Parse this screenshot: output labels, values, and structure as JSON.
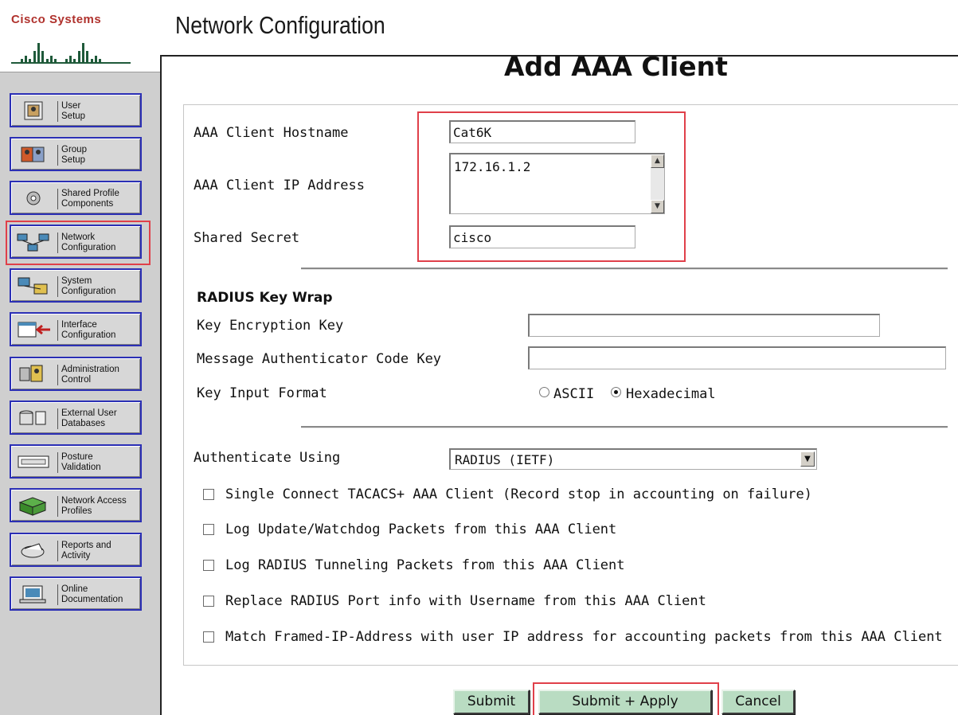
{
  "brand": {
    "name": "Cisco Systems"
  },
  "header": {
    "title": "Network Configuration"
  },
  "sidebar": {
    "items": [
      {
        "label": "User\nSetup",
        "icon": "user-setup-icon"
      },
      {
        "label": "Group\nSetup",
        "icon": "group-setup-icon"
      },
      {
        "label": "Shared Profile\nComponents",
        "icon": "shared-profile-icon"
      },
      {
        "label": "Network\nConfiguration",
        "icon": "network-config-icon",
        "selected": true
      },
      {
        "label": "System\nConfiguration",
        "icon": "system-config-icon"
      },
      {
        "label": "Interface\nConfiguration",
        "icon": "interface-config-icon"
      },
      {
        "label": "Administration\nControl",
        "icon": "admin-control-icon"
      },
      {
        "label": "External User\nDatabases",
        "icon": "external-db-icon"
      },
      {
        "label": "Posture\nValidation",
        "icon": "posture-icon"
      },
      {
        "label": "Network Access\nProfiles",
        "icon": "network-access-icon"
      },
      {
        "label": "Reports and\nActivity",
        "icon": "reports-icon"
      },
      {
        "label": "Online\nDocumentation",
        "icon": "documentation-icon"
      }
    ]
  },
  "main": {
    "page_title": "Add AAA Client",
    "hostname": {
      "label": "AAA Client Hostname",
      "value": "Cat6K"
    },
    "ip": {
      "label": "AAA Client IP Address",
      "value": "172.16.1.2"
    },
    "secret": {
      "label": "Shared Secret",
      "value": "cisco"
    },
    "key_wrap": {
      "heading": "RADIUS Key Wrap",
      "kek_label": "Key Encryption Key",
      "kek_value": "",
      "mack_label": "Message Authenticator Code Key",
      "mack_value": "",
      "format_label": "Key Input Format",
      "format_options": [
        "ASCII",
        "Hexadecimal"
      ],
      "format_selected": "Hexadecimal"
    },
    "auth": {
      "label": "Authenticate Using",
      "value": "RADIUS (IETF)"
    },
    "checkboxes": [
      {
        "label": "Single Connect TACACS+ AAA Client (Record stop in accounting on failure)",
        "checked": false
      },
      {
        "label": "Log Update/Watchdog Packets from this AAA Client",
        "checked": false
      },
      {
        "label": "Log RADIUS Tunneling Packets from this AAA Client",
        "checked": false
      },
      {
        "label": "Replace RADIUS Port info with Username from this AAA Client",
        "checked": false
      },
      {
        "label": "Match Framed-IP-Address with user IP address for accounting packets from this AAA Client",
        "checked": false
      }
    ],
    "buttons": {
      "submit": "Submit",
      "submit_apply": "Submit + Apply",
      "cancel": "Cancel"
    }
  },
  "colors": {
    "nav_border": "#2b2fb5",
    "highlight": "#e0404a",
    "button_bg": "#b9dcc2",
    "logo": "#b0322d"
  }
}
